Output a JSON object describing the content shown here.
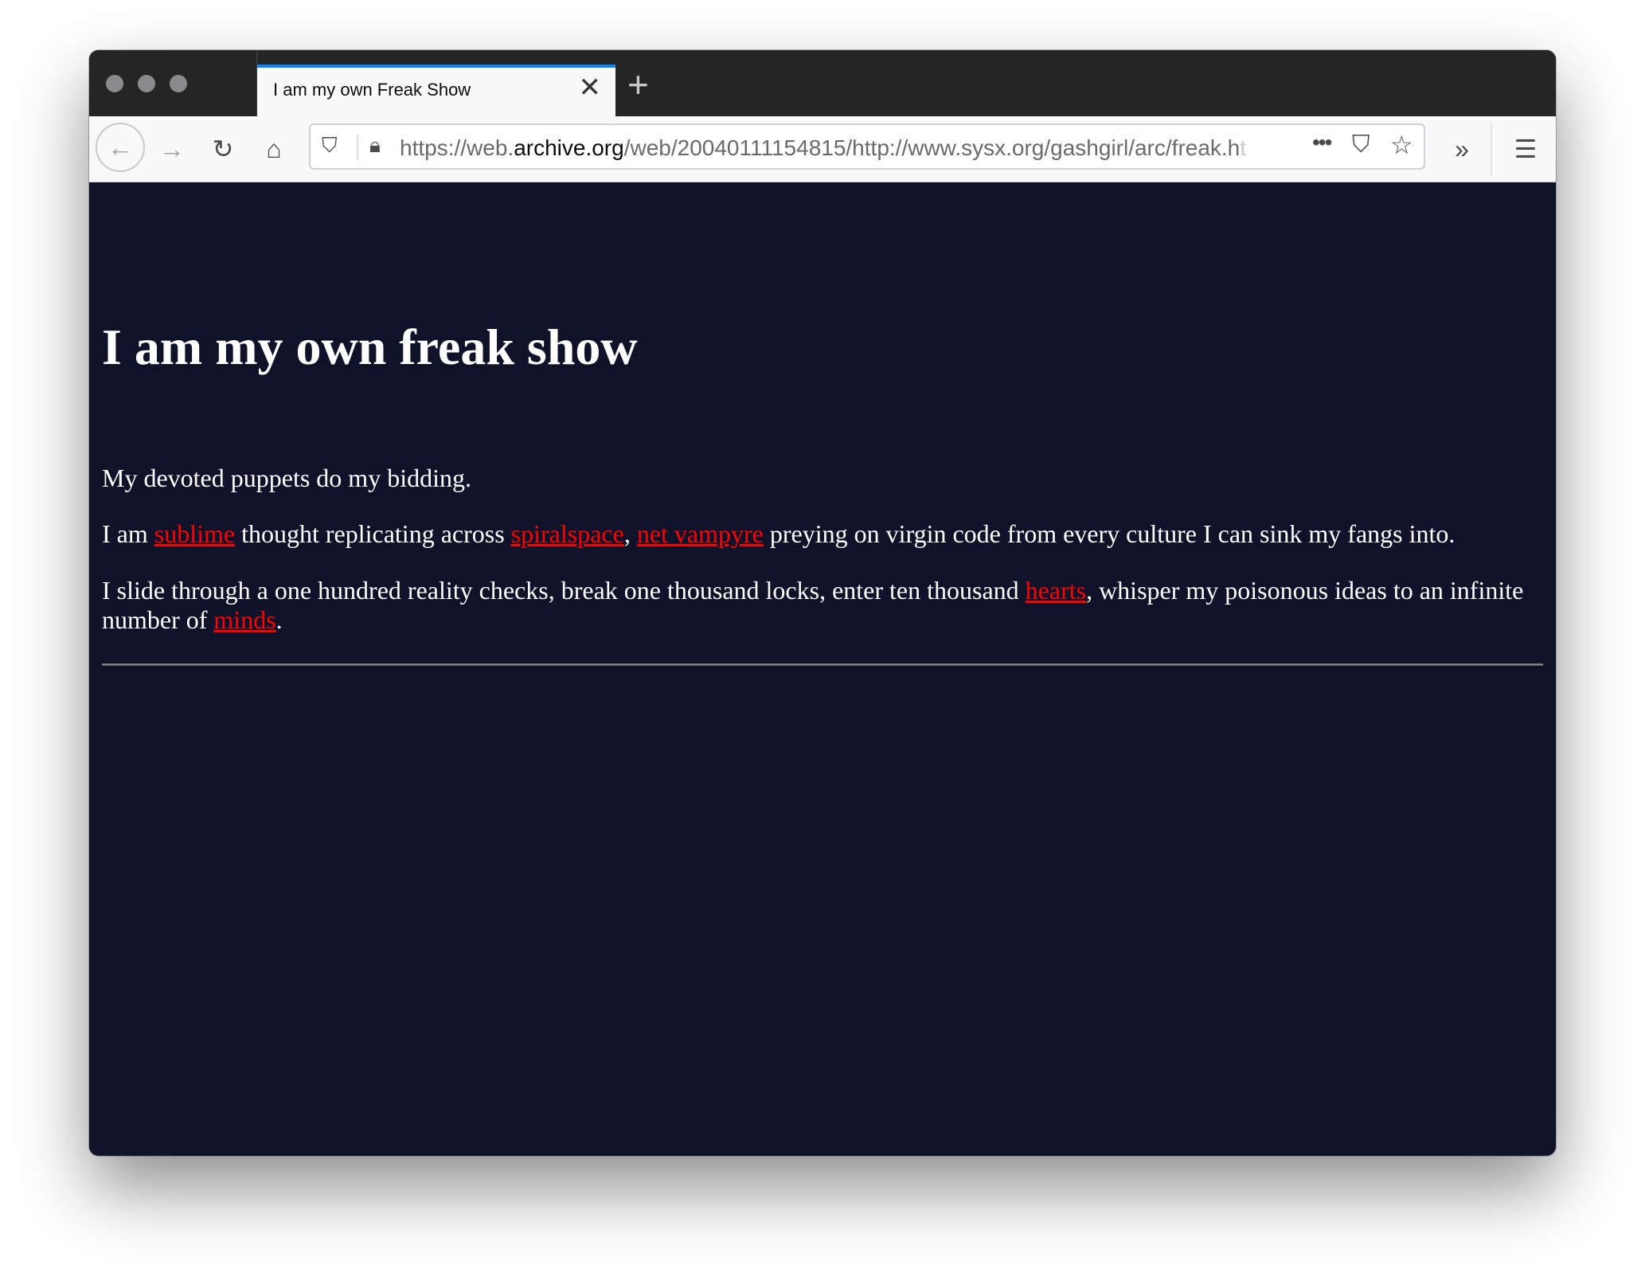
{
  "browser": {
    "tab_title": "I am my own Freak Show",
    "url_prefix": "https://web.",
    "url_domain": "archive.org",
    "url_rest": "/web/20040111154815/http://www.sysx.org/gashgirl/arc/freak.h",
    "url_fade": "t",
    "accent_color": "#0a84ff"
  },
  "page": {
    "heading": "I am my own freak show",
    "p1": "My devoted puppets do my bidding.",
    "p2": {
      "t1": "I am ",
      "link1": "sublime",
      "t2": " thought replicating across ",
      "link2": "spiralspace",
      "t3": ", ",
      "link3": "net vampyre",
      "t4": " preying on virgin code from every culture I can sink my fangs into."
    },
    "p3": {
      "t1": "I slide through a one hundred reality checks, break one thousand locks, enter ten thousand ",
      "link1": "hearts",
      "t2": ", whisper my poisonous ideas to an infinite number of ",
      "link2": "minds",
      "t3": "."
    },
    "background_color": "#10122a",
    "link_color": "#ff0000"
  }
}
